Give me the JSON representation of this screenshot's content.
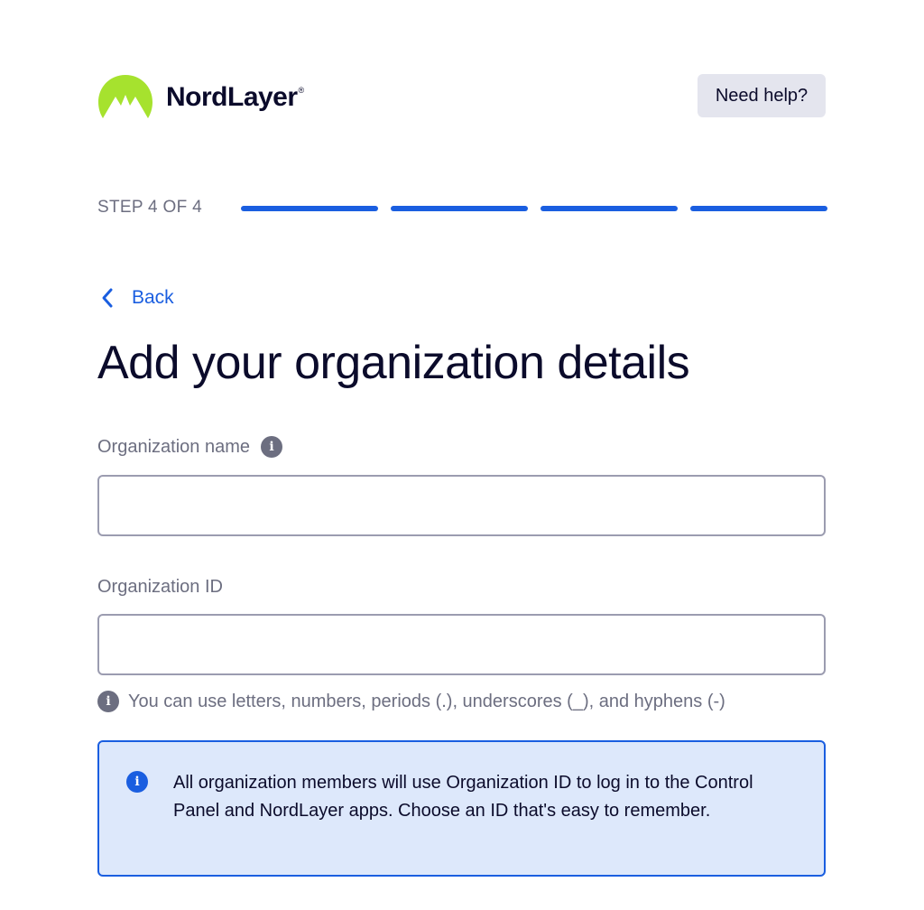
{
  "header": {
    "logo_text": "NordLayer",
    "logo_reg": "®",
    "help_label": "Need help?"
  },
  "progress": {
    "label": "STEP 4 OF 4",
    "current_step": 4,
    "total_steps": 4
  },
  "back_label": "Back",
  "title": "Add your organization details",
  "fields": {
    "org_name": {
      "label": "Organization name",
      "value": ""
    },
    "org_id": {
      "label": "Organization ID",
      "value": "",
      "hint": "You can use letters, numbers, periods (.), underscores (_), and hyphens (-)"
    }
  },
  "notice": {
    "text": "All organization members will use Organization ID to log in to the Control Panel and NordLayer apps. Choose an ID that's easy to remember."
  },
  "colors": {
    "brand_green": "#a6e22e",
    "accent_blue": "#1a5ee0",
    "notice_bg": "#dde8fb",
    "text_dark": "#0b0b2b",
    "text_muted": "#6c6e80"
  },
  "icons": {
    "logo": "nordlayer-mountain-logo",
    "back": "chevron-left-icon",
    "info": "info-icon"
  }
}
